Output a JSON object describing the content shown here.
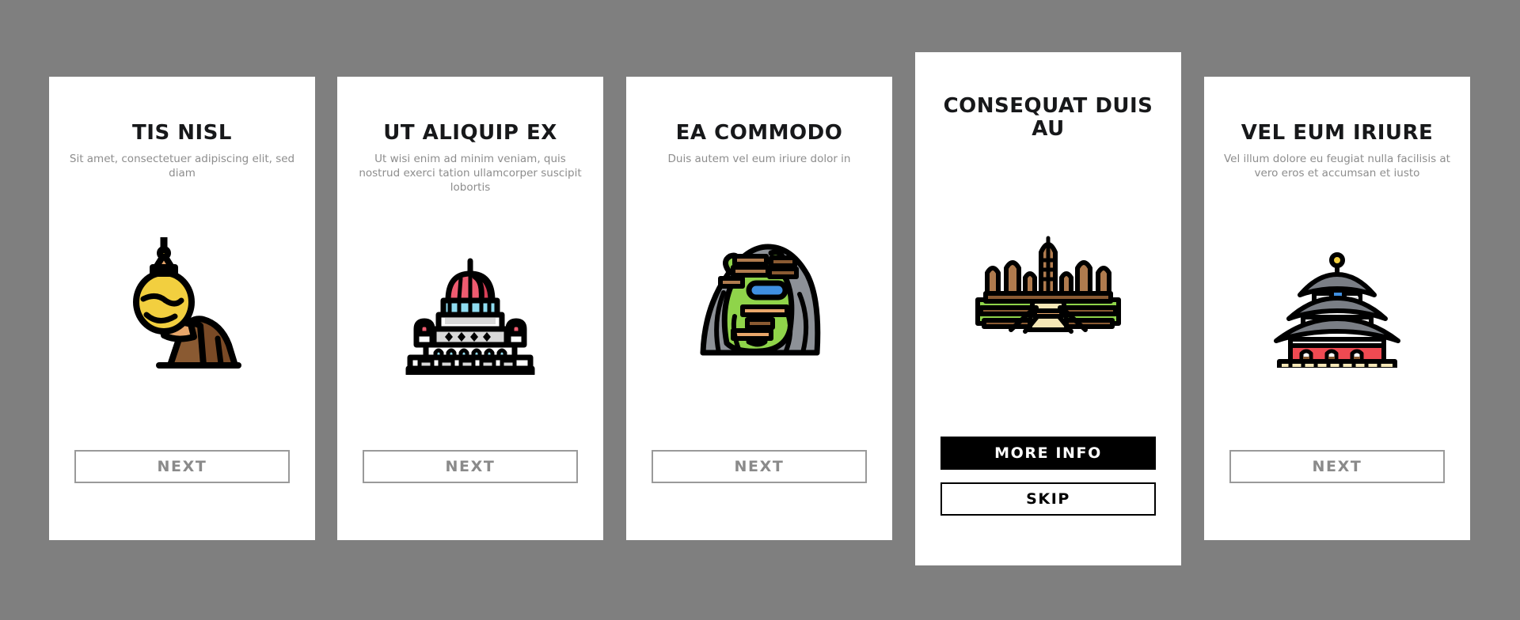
{
  "background_color": "#7f7f7f",
  "cards": [
    {
      "id": "card-1",
      "featured": false,
      "title": "TIS NISL",
      "subtitle": "Sit amet, consectetuer adipiscing elit, sed diam",
      "icon": "golden-rock-pagoda-icon",
      "buttons": [
        {
          "label": "NEXT",
          "style": "outline"
        }
      ]
    },
    {
      "id": "card-2",
      "featured": false,
      "title": "UT ALIQUIP EX",
      "subtitle": "Ut wisi enim ad minim veniam, quis nostrud exerci tation ullamcorper suscipit lobortis",
      "icon": "domed-capitol-building-icon",
      "buttons": [
        {
          "label": "NEXT",
          "style": "outline"
        }
      ]
    },
    {
      "id": "card-3",
      "featured": false,
      "title": "EA COMMODO",
      "subtitle": "Duis autem vel eum iriure dolor in",
      "icon": "rice-terraces-icon",
      "buttons": [
        {
          "label": "NEXT",
          "style": "outline"
        }
      ]
    },
    {
      "id": "card-4",
      "featured": true,
      "title": "CONSEQUAT DUIS AU",
      "subtitle": "",
      "icon": "angkor-wat-temple-icon",
      "buttons": [
        {
          "label": "MORE INFO",
          "style": "filled"
        },
        {
          "label": "SKIP",
          "style": "bordered"
        }
      ]
    },
    {
      "id": "card-5",
      "featured": false,
      "title": "VEL EUM IRIURE",
      "subtitle": "Vel illum dolore eu feugiat nulla facilisis at vero eros et accumsan et iusto",
      "icon": "temple-of-heaven-icon",
      "buttons": [
        {
          "label": "NEXT",
          "style": "outline"
        }
      ]
    }
  ],
  "palette": {
    "outline": "#000000",
    "gold": "#f2cf3f",
    "gold_light": "#f6dc63",
    "orange": "#e8a66a",
    "brown": "#7a4a26",
    "brown_light": "#b07b4e",
    "brown_mid": "#8a5a32",
    "pink": "#ef5b70",
    "pink_dark": "#d94057",
    "cyan": "#8fdcf0",
    "gray_light": "#d8d8d8",
    "gray_mid": "#9a9a9a",
    "gray_roof": "#7a7e85",
    "green": "#8fd44a",
    "green_dark": "#6cb52f",
    "blue": "#3f8fe0",
    "cream": "#f5e7b6",
    "red": "#ef4a52",
    "white": "#ffffff"
  }
}
